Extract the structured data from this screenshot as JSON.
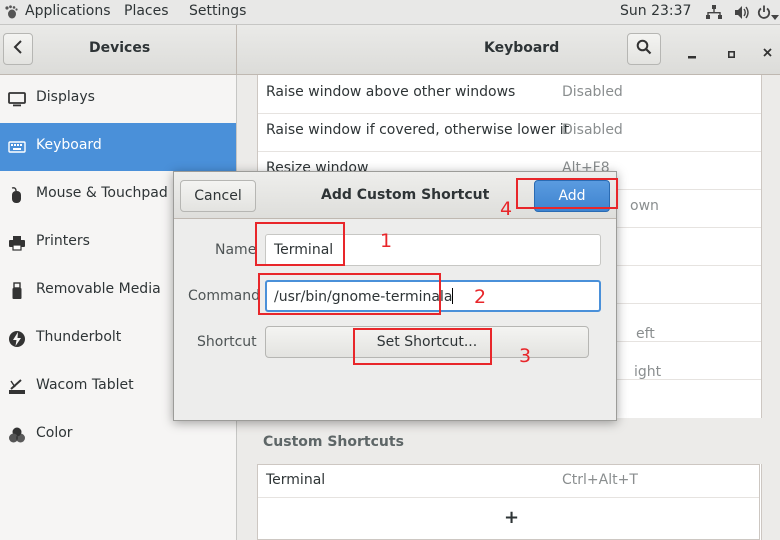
{
  "topbar": {
    "applications": "Applications",
    "places": "Places",
    "settings": "Settings",
    "clock": "Sun 23:37"
  },
  "header": {
    "sidebar_title": "Devices",
    "main_title": "Keyboard"
  },
  "sidebar": {
    "items": [
      {
        "label": "Displays",
        "icon": "display-icon"
      },
      {
        "label": "Keyboard",
        "icon": "keyboard-icon"
      },
      {
        "label": "Mouse & Touchpad",
        "icon": "mouse-icon"
      },
      {
        "label": "Printers",
        "icon": "printer-icon"
      },
      {
        "label": "Removable Media",
        "icon": "usb-icon"
      },
      {
        "label": "Thunderbolt",
        "icon": "thunderbolt-icon"
      },
      {
        "label": "Wacom Tablet",
        "icon": "tablet-icon"
      },
      {
        "label": "Color",
        "icon": "color-icon"
      }
    ]
  },
  "shortcuts": {
    "rows": [
      {
        "name": "Raise window above other windows",
        "accel": "Disabled"
      },
      {
        "name": "Raise window if covered, otherwise lower it",
        "accel": "Disabled"
      },
      {
        "name": "Resize window",
        "accel": "Alt+F8"
      }
    ],
    "partial_right": [
      "own",
      "eft",
      "ight"
    ],
    "custom_title": "Custom Shortcuts",
    "custom_rows": [
      {
        "name": "Terminal",
        "accel": "Ctrl+Alt+T"
      }
    ],
    "add_symbol": "+"
  },
  "dialog": {
    "title": "Add Custom Shortcut",
    "cancel_label": "Cancel",
    "add_label": "Add",
    "name_label": "Name",
    "name_value": "Terminal",
    "command_label": "Command",
    "command_value": "/usr/bin/gnome-terminala",
    "shortcut_label": "Shortcut",
    "set_shortcut_label": "Set Shortcut..."
  },
  "annotations": [
    "1",
    "2",
    "3",
    "4"
  ],
  "colors": {
    "accent": "#4a90d9",
    "annotation": "#e8262a"
  }
}
